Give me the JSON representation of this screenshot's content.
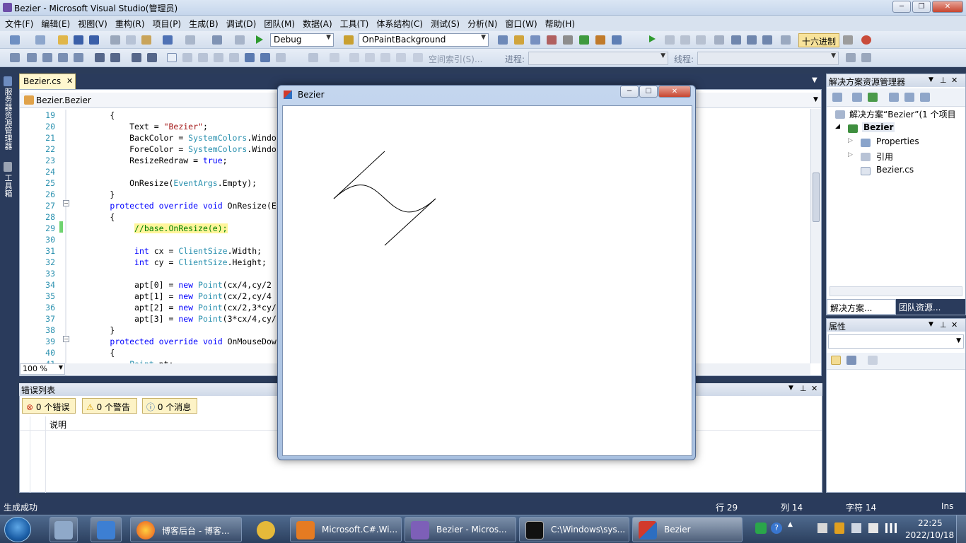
{
  "window": {
    "title": "Bezier - Microsoft Visual Studio(管理员)",
    "minimize": "─",
    "restore": "❐",
    "close": "✕"
  },
  "menu": [
    "文件(F)",
    "编辑(E)",
    "视图(V)",
    "重构(R)",
    "项目(P)",
    "生成(B)",
    "调试(D)",
    "团队(M)",
    "数据(A)",
    "工具(T)",
    "体系结构(C)",
    "测试(S)",
    "分析(N)",
    "窗口(W)",
    "帮助(H)"
  ],
  "toolbar": {
    "config": "Debug",
    "member": "OnPaintBackground",
    "hex_label": "十六进制",
    "search_label": "空间索引(S)...",
    "process_label": "进程:",
    "thread_label": "线程:"
  },
  "side_tools": [
    "服务器资源管理器",
    "工具箱"
  ],
  "editor": {
    "tab": "Bezier.cs",
    "tab_close": "✕",
    "nav_class": "Bezier.Bezier",
    "zoom": "100 %",
    "lines": [
      {
        "n": "19",
        "code": "        {"
      },
      {
        "n": "20",
        "code": "            Text = \"Bezier\";"
      },
      {
        "n": "21",
        "code": "            BackColor = SystemColors.Windo"
      },
      {
        "n": "22",
        "code": "            ForeColor = SystemColors.Windo"
      },
      {
        "n": "23",
        "code": "            ResizeRedraw = true;"
      },
      {
        "n": "24",
        "code": ""
      },
      {
        "n": "25",
        "code": "            OnResize(EventArgs.Empty);"
      },
      {
        "n": "26",
        "code": "        }"
      },
      {
        "n": "27",
        "code": "        protected override void OnResize(E"
      },
      {
        "n": "28",
        "code": "        {"
      },
      {
        "n": "29",
        "code": "             //base.OnResize(e);"
      },
      {
        "n": "30",
        "code": ""
      },
      {
        "n": "31",
        "code": "             int cx = ClientSize.Width;"
      },
      {
        "n": "32",
        "code": "             int cy = ClientSize.Height;"
      },
      {
        "n": "33",
        "code": ""
      },
      {
        "n": "34",
        "code": "             apt[0] = new Point(cx/4,cy/2"
      },
      {
        "n": "35",
        "code": "             apt[1] = new Point(cx/2,cy/4"
      },
      {
        "n": "36",
        "code": "             apt[2] = new Point(cx/2,3*cy/"
      },
      {
        "n": "37",
        "code": "             apt[3] = new Point(3*cx/4,cy/"
      },
      {
        "n": "38",
        "code": "        }"
      },
      {
        "n": "39",
        "code": "        protected override void OnMouseDow"
      },
      {
        "n": "40",
        "code": "        {"
      },
      {
        "n": "41",
        "code": "            Point pt;"
      }
    ]
  },
  "error_list": {
    "title": "错误列表",
    "errors": "0 个错误",
    "warnings": "0 个警告",
    "messages": "0 个消息",
    "col_desc": "说明"
  },
  "solution_explorer": {
    "title": "解决方案资源管理器",
    "solution": "解决方案“Bezier”(1 个项目",
    "project": "Bezier",
    "items": [
      "Properties",
      "引用",
      "Bezier.cs"
    ],
    "tab1": "解决方案...",
    "tab2": "团队资源..."
  },
  "properties": {
    "title": "属性"
  },
  "bezier_window": {
    "title": "Bezier"
  },
  "status": {
    "left": "生成成功",
    "row": "行 29",
    "col": "列 14",
    "ch": "字符 14",
    "ins": "Ins"
  },
  "taskbar": {
    "items": [
      "博客后台 - 博客...",
      "Microsoft.C#.Wi...",
      "Bezier - Micros...",
      "C:\\Windows\\sys...",
      "Bezier"
    ],
    "time": "22:25",
    "date": "2022/10/18"
  }
}
